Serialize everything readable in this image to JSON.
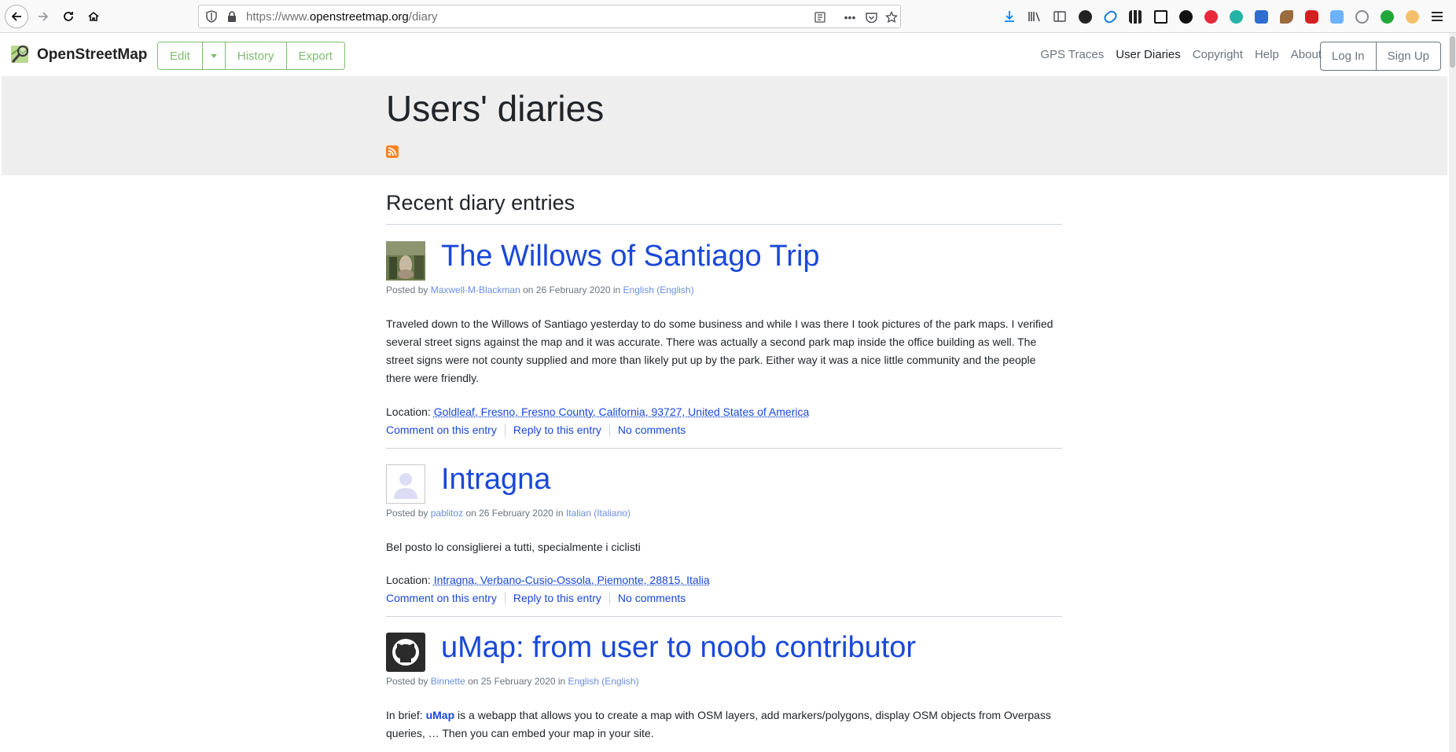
{
  "browser": {
    "url_prefix": "https://www.",
    "url_domain": "openstreetmap.org",
    "url_path": "/diary"
  },
  "header": {
    "brand": "OpenStreetMap",
    "edit_label": "Edit",
    "history_label": "History",
    "export_label": "Export",
    "nav": [
      "GPS Traces",
      "User Diaries",
      "Copyright",
      "Help",
      "About"
    ],
    "login_label": "Log In",
    "signup_label": "Sign Up"
  },
  "page": {
    "title": "Users' diaries",
    "section_title": "Recent diary entries"
  },
  "entries": [
    {
      "title": "The Willows of Santiago Trip",
      "posted_by": "Posted by",
      "author": "Maxwell-M-Blackman",
      "date": "on 26 February 2020 in",
      "language": "English (English)",
      "body": "Traveled down to the Willows of Santiago yesterday to do some business and while I was there I took pictures of the park maps. I verified several street signs against the map and it was accurate. There was actually a second park map inside the office building as well. The street signs were not county supplied and more than likely put up by the park. Either way it was a nice little community and the people there were friendly.",
      "location_label": "Location:",
      "location": "Goldleaf, Fresno, Fresno County, California, 93727, United States of America",
      "comment": "Comment on this entry",
      "reply": "Reply to this entry",
      "comments": "No comments"
    },
    {
      "title": "Intragna",
      "posted_by": "Posted by",
      "author": "pablitoz",
      "date": "on 26 February 2020 in",
      "language": "Italian (Italiano)",
      "body": "Bel posto lo consiglierei a tutti, specialmente i ciclisti",
      "location_label": "Location:",
      "location": "Intragna, Verbano-Cusio-Ossola, Piemonte, 28815, Italia",
      "comment": "Comment on this entry",
      "reply": "Reply to this entry",
      "comments": "No comments"
    },
    {
      "title": "uMap: from user to noob contributor",
      "posted_by": "Posted by",
      "author": "Binnette",
      "date": "on 25 February 2020 in",
      "language": "English (English)",
      "body_prefix": "In brief: ",
      "body_link": "uMap",
      "body": " is a webapp that allows you to create a map with OSM layers, add markers/polygons, display OSM objects from Overpass queries, … Then you can embed your map in your site."
    }
  ],
  "colors": {
    "osm_green": "#7ebc6f",
    "link_blue": "#1a48d8",
    "hero_bg": "#eeeeee"
  }
}
